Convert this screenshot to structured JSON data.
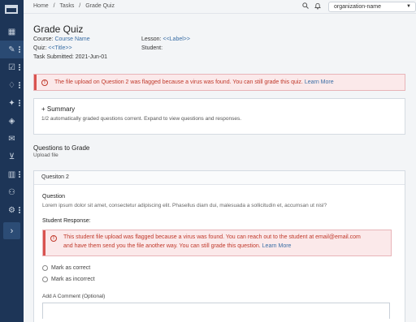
{
  "breadcrumb": [
    "Home",
    "/",
    "Tasks",
    "/",
    "Grade Quiz"
  ],
  "org": {
    "name": "organization-name"
  },
  "page": {
    "title": "Grade Quiz",
    "course_label": "Course:",
    "course_value": "Course Name",
    "lesson_label": "Lesson:",
    "lesson_value": "<<Label>>",
    "quiz_label": "Quiz:",
    "quiz_value": "<<Title>>",
    "student_label": "Student:",
    "student_value": "",
    "submitted_label": "Task Submitted:",
    "submitted_value": "2021-Jun-01"
  },
  "alert_top": {
    "text": "The file upload on Question 2 was flagged because a virus was found. You can still grade this quiz.",
    "link": "Learn More"
  },
  "summary": {
    "title": "+ Summary",
    "desc": "1/2 automatically graded questions corrent. Expand to view questions and responses."
  },
  "section": {
    "title": "Questions to Grade",
    "subtitle": "Upload file"
  },
  "question": {
    "header": "Quesiton 2",
    "label": "Question",
    "text": "Lorem ipsum dolor sit amet, consectetur adipiscing elit. Phasellus diam dui, malesuada a sollicitudin et, accumsan ut nisl?",
    "response_label": "Student Response:",
    "alert_line1": "This student file upload was flagged because a virus was found. You can reach out to the student at email@email.com",
    "alert_line2": "and have them send you the file another way. You can still grade this question.",
    "alert_link": "Learn More",
    "mark_correct": "Mark as correct",
    "mark_incorrect": "Mark as incorrect",
    "comment_label": "Add A Comment (Optional)"
  },
  "icons": {
    "search": "search-icon",
    "bell": "bell-icon",
    "caret": "chevron-down-icon"
  },
  "colors": {
    "sidebar": "#1d3557",
    "alert_bg": "#fbe9ea",
    "alert_text": "#c0392b",
    "link": "#3a6ea5"
  }
}
